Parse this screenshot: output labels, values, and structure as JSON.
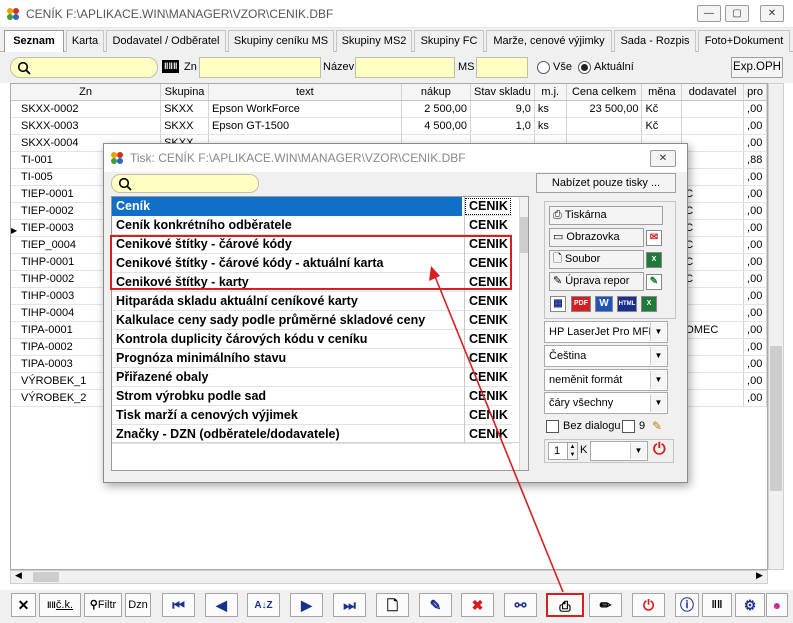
{
  "window": {
    "title": "CENÍK F:\\APLIKACE.WIN\\MANAGER\\VZOR\\CENIK.DBF"
  },
  "tabs": [
    {
      "label": "Seznam"
    },
    {
      "label": "Karta"
    },
    {
      "label": "Dodavatel / Odběratel"
    },
    {
      "label": "Skupiny ceníku MS"
    },
    {
      "label": "Skupiny MS2"
    },
    {
      "label": "Skupiny FC"
    },
    {
      "label": "Marže, cenové výjimky"
    },
    {
      "label": "Sada - Rozpis"
    },
    {
      "label": "Foto+Dokument"
    }
  ],
  "filter": {
    "zn_label": "Zn",
    "nazev_label": "Název",
    "ms_label": "MS",
    "radio_all": "Vše",
    "radio_current": "Aktuální",
    "export_button": "Exp.OPH",
    "barcode_glyph": "ǁǁǁ"
  },
  "grid": {
    "columns": [
      "Zn",
      "Skupina",
      "text",
      "nákup",
      "Stav skladu",
      "m.j.",
      "Cena celkem",
      "měna",
      "dodavatel",
      "pro"
    ],
    "rows": [
      [
        "SKXX-0002",
        "SKXX",
        "Epson WorkForce",
        "2 500,00",
        "9,0",
        "ks",
        "23 500,00",
        "Kč",
        "",
        ",00"
      ],
      [
        "SKXX-0003",
        "SKXX",
        "Epson GT-1500",
        "4 500,00",
        "1,0",
        "ks",
        "",
        "Kč",
        "",
        ",00"
      ],
      [
        "SKXX-0004",
        "SKXX",
        "",
        "",
        "",
        "",
        "",
        "",
        "",
        ",00"
      ],
      [
        "TI-001",
        "",
        "",
        "",
        "",
        "",
        "",
        "",
        "",
        ",88"
      ],
      [
        "TI-005",
        "",
        "",
        "",
        "",
        "",
        "",
        "",
        "",
        ",00"
      ],
      [
        "TIEP-0001",
        "",
        "",
        "",
        "",
        "",
        "",
        "",
        "C",
        ",00"
      ],
      [
        "TIEP-0002",
        "",
        "",
        "",
        "",
        "",
        "",
        "",
        "C",
        ",00"
      ],
      [
        "TIEP-0003",
        "",
        "",
        "",
        "",
        "",
        "",
        "",
        "C",
        ",00"
      ],
      [
        "TIEP_0004",
        "",
        "",
        "",
        "",
        "",
        "",
        "",
        "C",
        ",00"
      ],
      [
        "TIHP-0001",
        "",
        "",
        "",
        "",
        "",
        "",
        "",
        "C",
        ",00"
      ],
      [
        "TIHP-0002",
        "",
        "",
        "",
        "",
        "",
        "",
        "",
        "C",
        ",00"
      ],
      [
        "TIHP-0003",
        "",
        "",
        "",
        "",
        "",
        "",
        "",
        "",
        ",00"
      ],
      [
        "TIHP-0004",
        "",
        "",
        "",
        "",
        "",
        "",
        "",
        "",
        ",00"
      ],
      [
        "TIPA-0001",
        "",
        "",
        "",
        "",
        "",
        "",
        "",
        "OMEC",
        ",00"
      ],
      [
        "TIPA-0002",
        "",
        "",
        "",
        "",
        "",
        "",
        "",
        "",
        ",00"
      ],
      [
        "TIPA-0003",
        "",
        "",
        "",
        "",
        "",
        "",
        "",
        "",
        ",00"
      ],
      [
        "VÝROBEK_1",
        "",
        "",
        "",
        "",
        "",
        "",
        "",
        "",
        ",00"
      ],
      [
        "VÝROBEK_2",
        "",
        "",
        "",
        "",
        "",
        "",
        "",
        "",
        ",00"
      ]
    ],
    "current_row_marker": "▶"
  },
  "dialog": {
    "title": "Tisk: CENÍK F:\\APLIKACE.WIN\\MANAGER\\VZOR\\CENIK.DBF",
    "offer_button": "Nabízet pouze tisky ...",
    "items": [
      {
        "name": "Ceník",
        "code": "CENIK"
      },
      {
        "name": "Ceník konkrétního odběratele",
        "code": "CENIK"
      },
      {
        "name": "Cenikové štítky - čárové kódy",
        "code": "CENIK"
      },
      {
        "name": "Cenikové štítky - čárové kódy - aktuální karta",
        "code": "CENIK"
      },
      {
        "name": "Cenikové štítky - karty",
        "code": "CENIK"
      },
      {
        "name": "Hitparáda skladu aktuální ceníkové karty",
        "code": "CENIK"
      },
      {
        "name": "Kalkulace ceny sady podle průměrné skladové ceny",
        "code": "CENIK"
      },
      {
        "name": "Kontrola duplicity čárových kódu v ceníku",
        "code": "CENIK"
      },
      {
        "name": "Prognóza minimálního stavu",
        "code": "CENIK"
      },
      {
        "name": "Přiřazené obaly",
        "code": "CENIK"
      },
      {
        "name": "Strom výrobku podle sad",
        "code": "CENIK"
      },
      {
        "name": "Tisk marží a cenových výjimek",
        "code": "CENIK"
      },
      {
        "name": "Značky - DZN (odběratele/dodavatele)",
        "code": "CENIK"
      }
    ],
    "btn_printer": "Tiskárna",
    "btn_screen": "Obrazovka",
    "btn_file": "Soubor",
    "btn_edit": "Úprava repor",
    "export_icons": [
      "PDF",
      "W",
      "HTML",
      "X"
    ],
    "printer_select": "HP LaserJet Pro MFP",
    "language_select": "Čeština",
    "format_select": "neměnit formát",
    "lines_select": "čáry všechny",
    "no_dialog_label": "Bez dialogu",
    "count_label": "9",
    "copies_value": "1",
    "copies_suffix": "K"
  },
  "toolbar": {
    "ck_label": "č.k.",
    "filter_label": "Filtr",
    "dzn_label": "Dzn"
  },
  "colors": {
    "accent": "#1070c8",
    "highlight_box": "#d42020",
    "yellow_field": "#ffffc4"
  }
}
